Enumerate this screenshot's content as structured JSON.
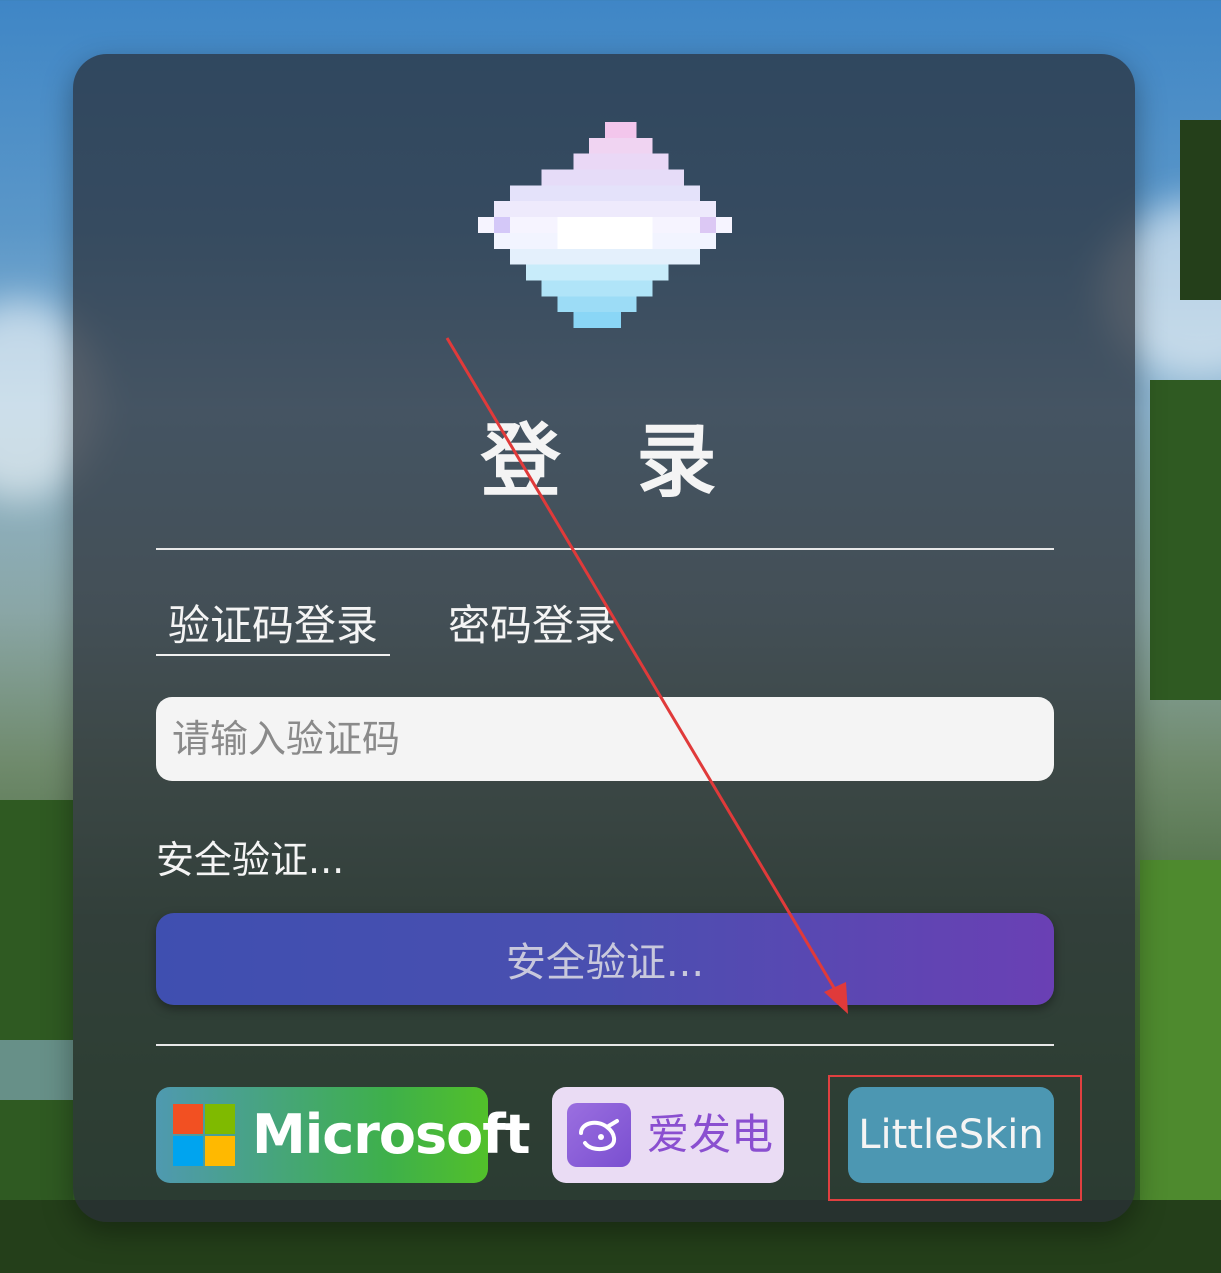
{
  "title": "登 录",
  "tabs": [
    {
      "label": "验证码登录",
      "active": true
    },
    {
      "label": "密码登录",
      "active": false
    }
  ],
  "code_input": {
    "placeholder": "请输入验证码",
    "value": ""
  },
  "captcha_status": "安全验证...",
  "submit_label": "安全验证...",
  "oauth": {
    "microsoft": "Microsoft",
    "afdian": "爱发电",
    "littleskin": "LittleSkin"
  },
  "colors": {
    "card": "#282e38",
    "submit_start": "#3f4fb0",
    "submit_end": "#6a40b4",
    "microsoft_green": "#52c02a",
    "afdian_bg": "#eadcf4",
    "afdian_text": "#8a4fd0",
    "littleskin_bg": "#4c97b2",
    "annotation_red": "#e04040"
  },
  "icons": [
    "pixel-cloud-logo-icon",
    "microsoft-logo-icon",
    "afdian-logo-icon"
  ]
}
